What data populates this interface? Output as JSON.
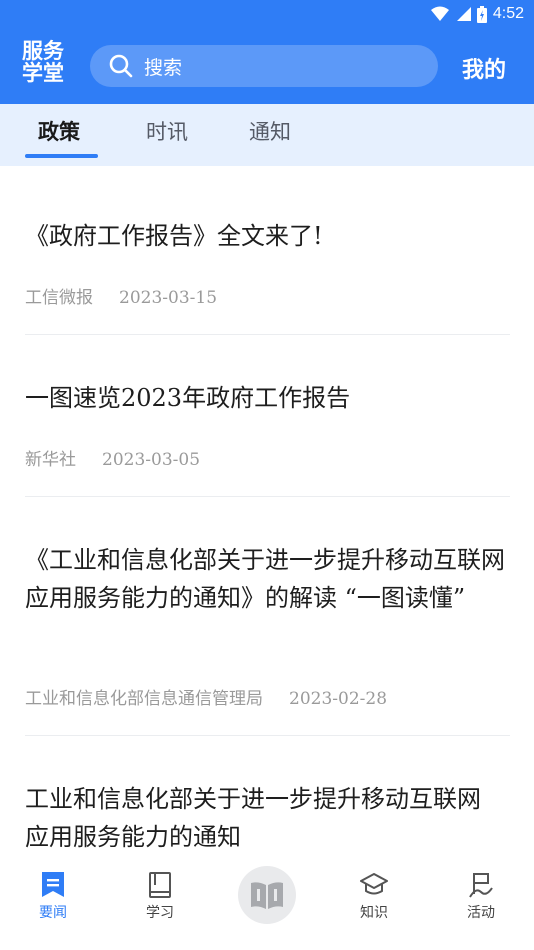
{
  "status_bar": {
    "time": "4:52"
  },
  "header": {
    "logo_line1": "服务",
    "logo_line2": "学堂",
    "search_placeholder": "搜索",
    "mine_label": "我的"
  },
  "tabs": [
    {
      "label": "政策",
      "active": true
    },
    {
      "label": "时讯",
      "active": false
    },
    {
      "label": "通知",
      "active": false
    }
  ],
  "articles": [
    {
      "title": "《政府工作报告》全文来了!",
      "source": "工信微报",
      "date": "2023-03-15"
    },
    {
      "title": "一图速览2023年政府工作报告",
      "source": "新华社",
      "date": "2023-03-05"
    },
    {
      "title": "《工业和信息化部关于进一步提升移动互联网应用服务能力的通知》的解读 “一图读懂”",
      "source": "工业和信息化部信息通信管理局",
      "date": "2023-02-28"
    },
    {
      "title": "工业和信息化部关于进一步提升移动互联网应用服务能力的通知",
      "source": "",
      "date": ""
    }
  ],
  "bottom_nav": [
    {
      "label": "要闻",
      "icon": "news-icon",
      "active": true
    },
    {
      "label": "学习",
      "icon": "book-icon",
      "active": false
    },
    {
      "label": "",
      "icon": "open-book-icon",
      "active": false
    },
    {
      "label": "知识",
      "icon": "graduation-cap-icon",
      "active": false
    },
    {
      "label": "活动",
      "icon": "activity-icon",
      "active": false
    }
  ],
  "colors": {
    "accent": "#2f7df6",
    "tab_bg": "#e6f0fe",
    "meta_text": "#9a9a9a"
  }
}
